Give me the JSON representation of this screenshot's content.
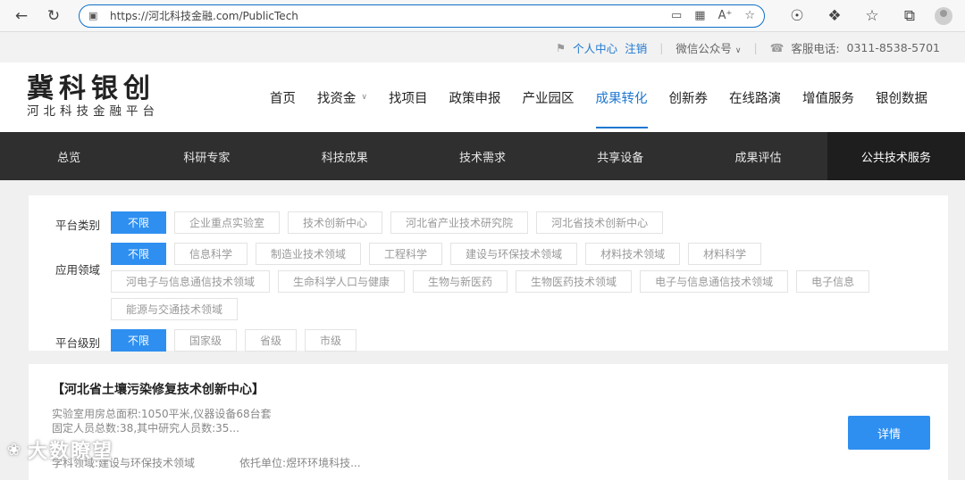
{
  "browser": {
    "url": "https://河北科技金融.com/PublicTech"
  },
  "topinfo": {
    "user_center": "个人中心",
    "logout": "注销",
    "wechat": "微信公众号",
    "phone_label": "客服电话:",
    "phone": "0311-8538-5701"
  },
  "logo": {
    "line1": "冀科银创",
    "line2": "河北科技金融平台"
  },
  "mainnav": [
    "首页",
    "找资金",
    "找项目",
    "政策申报",
    "产业园区",
    "成果转化",
    "创新券",
    "在线路演",
    "增值服务",
    "银创数据"
  ],
  "subnav": [
    "总览",
    "科研专家",
    "科技成果",
    "技术需求",
    "共享设备",
    "成果评估",
    "公共技术服务"
  ],
  "filter": {
    "platform_type": {
      "label": "平台类别",
      "tags": [
        "不限",
        "企业重点实验室",
        "技术创新中心",
        "河北省产业技术研究院",
        "河北省技术创新中心"
      ]
    },
    "field": {
      "label": "应用领域",
      "tags": [
        "不限",
        "信息科学",
        "制造业技术领域",
        "工程科学",
        "建设与环保技术领域",
        "材料技术领域",
        "材料科学",
        "河电子与信息通信技术领域",
        "生命科学人口与健康",
        "生物与新医药",
        "生物医药技术领域",
        "电子与信息通信技术领域",
        "电子信息",
        "能源与交通技术领域"
      ]
    },
    "level": {
      "label": "平台级别",
      "tags": [
        "不限",
        "国家级",
        "省级",
        "市级"
      ]
    }
  },
  "card": {
    "title": "【河北省土壤污染修复技术创新中心】",
    "line1": "实验室用房总面积:1050平米,仪器设备68台套",
    "line2": "固定人员总数:38,其中研究人员数:35...",
    "field": "学科领域:建设与环保技术领域",
    "org": "依托单位:煜环环境科技...",
    "detail_button": "详情"
  },
  "watermark": "大数瞭望",
  "colors": {
    "accent": "#2e8ff0",
    "subnav_bg": "#2f2f2f"
  }
}
